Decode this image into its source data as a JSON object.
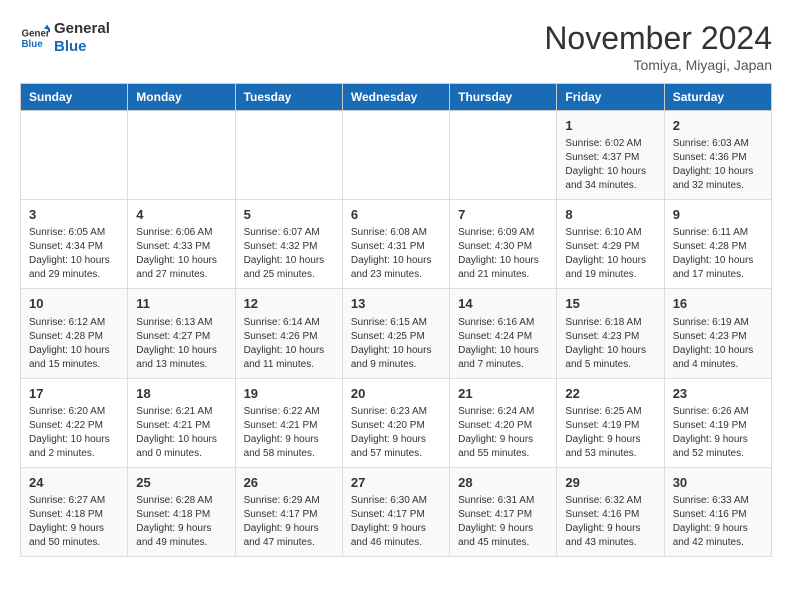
{
  "logo": {
    "line1": "General",
    "line2": "Blue"
  },
  "title": "November 2024",
  "location": "Tomiya, Miyagi, Japan",
  "days_of_week": [
    "Sunday",
    "Monday",
    "Tuesday",
    "Wednesday",
    "Thursday",
    "Friday",
    "Saturday"
  ],
  "weeks": [
    [
      {
        "day": "",
        "info": ""
      },
      {
        "day": "",
        "info": ""
      },
      {
        "day": "",
        "info": ""
      },
      {
        "day": "",
        "info": ""
      },
      {
        "day": "",
        "info": ""
      },
      {
        "day": "1",
        "info": "Sunrise: 6:02 AM\nSunset: 4:37 PM\nDaylight: 10 hours and 34 minutes."
      },
      {
        "day": "2",
        "info": "Sunrise: 6:03 AM\nSunset: 4:36 PM\nDaylight: 10 hours and 32 minutes."
      }
    ],
    [
      {
        "day": "3",
        "info": "Sunrise: 6:05 AM\nSunset: 4:34 PM\nDaylight: 10 hours and 29 minutes."
      },
      {
        "day": "4",
        "info": "Sunrise: 6:06 AM\nSunset: 4:33 PM\nDaylight: 10 hours and 27 minutes."
      },
      {
        "day": "5",
        "info": "Sunrise: 6:07 AM\nSunset: 4:32 PM\nDaylight: 10 hours and 25 minutes."
      },
      {
        "day": "6",
        "info": "Sunrise: 6:08 AM\nSunset: 4:31 PM\nDaylight: 10 hours and 23 minutes."
      },
      {
        "day": "7",
        "info": "Sunrise: 6:09 AM\nSunset: 4:30 PM\nDaylight: 10 hours and 21 minutes."
      },
      {
        "day": "8",
        "info": "Sunrise: 6:10 AM\nSunset: 4:29 PM\nDaylight: 10 hours and 19 minutes."
      },
      {
        "day": "9",
        "info": "Sunrise: 6:11 AM\nSunset: 4:28 PM\nDaylight: 10 hours and 17 minutes."
      }
    ],
    [
      {
        "day": "10",
        "info": "Sunrise: 6:12 AM\nSunset: 4:28 PM\nDaylight: 10 hours and 15 minutes."
      },
      {
        "day": "11",
        "info": "Sunrise: 6:13 AM\nSunset: 4:27 PM\nDaylight: 10 hours and 13 minutes."
      },
      {
        "day": "12",
        "info": "Sunrise: 6:14 AM\nSunset: 4:26 PM\nDaylight: 10 hours and 11 minutes."
      },
      {
        "day": "13",
        "info": "Sunrise: 6:15 AM\nSunset: 4:25 PM\nDaylight: 10 hours and 9 minutes."
      },
      {
        "day": "14",
        "info": "Sunrise: 6:16 AM\nSunset: 4:24 PM\nDaylight: 10 hours and 7 minutes."
      },
      {
        "day": "15",
        "info": "Sunrise: 6:18 AM\nSunset: 4:23 PM\nDaylight: 10 hours and 5 minutes."
      },
      {
        "day": "16",
        "info": "Sunrise: 6:19 AM\nSunset: 4:23 PM\nDaylight: 10 hours and 4 minutes."
      }
    ],
    [
      {
        "day": "17",
        "info": "Sunrise: 6:20 AM\nSunset: 4:22 PM\nDaylight: 10 hours and 2 minutes."
      },
      {
        "day": "18",
        "info": "Sunrise: 6:21 AM\nSunset: 4:21 PM\nDaylight: 10 hours and 0 minutes."
      },
      {
        "day": "19",
        "info": "Sunrise: 6:22 AM\nSunset: 4:21 PM\nDaylight: 9 hours and 58 minutes."
      },
      {
        "day": "20",
        "info": "Sunrise: 6:23 AM\nSunset: 4:20 PM\nDaylight: 9 hours and 57 minutes."
      },
      {
        "day": "21",
        "info": "Sunrise: 6:24 AM\nSunset: 4:20 PM\nDaylight: 9 hours and 55 minutes."
      },
      {
        "day": "22",
        "info": "Sunrise: 6:25 AM\nSunset: 4:19 PM\nDaylight: 9 hours and 53 minutes."
      },
      {
        "day": "23",
        "info": "Sunrise: 6:26 AM\nSunset: 4:19 PM\nDaylight: 9 hours and 52 minutes."
      }
    ],
    [
      {
        "day": "24",
        "info": "Sunrise: 6:27 AM\nSunset: 4:18 PM\nDaylight: 9 hours and 50 minutes."
      },
      {
        "day": "25",
        "info": "Sunrise: 6:28 AM\nSunset: 4:18 PM\nDaylight: 9 hours and 49 minutes."
      },
      {
        "day": "26",
        "info": "Sunrise: 6:29 AM\nSunset: 4:17 PM\nDaylight: 9 hours and 47 minutes."
      },
      {
        "day": "27",
        "info": "Sunrise: 6:30 AM\nSunset: 4:17 PM\nDaylight: 9 hours and 46 minutes."
      },
      {
        "day": "28",
        "info": "Sunrise: 6:31 AM\nSunset: 4:17 PM\nDaylight: 9 hours and 45 minutes."
      },
      {
        "day": "29",
        "info": "Sunrise: 6:32 AM\nSunset: 4:16 PM\nDaylight: 9 hours and 43 minutes."
      },
      {
        "day": "30",
        "info": "Sunrise: 6:33 AM\nSunset: 4:16 PM\nDaylight: 9 hours and 42 minutes."
      }
    ]
  ]
}
